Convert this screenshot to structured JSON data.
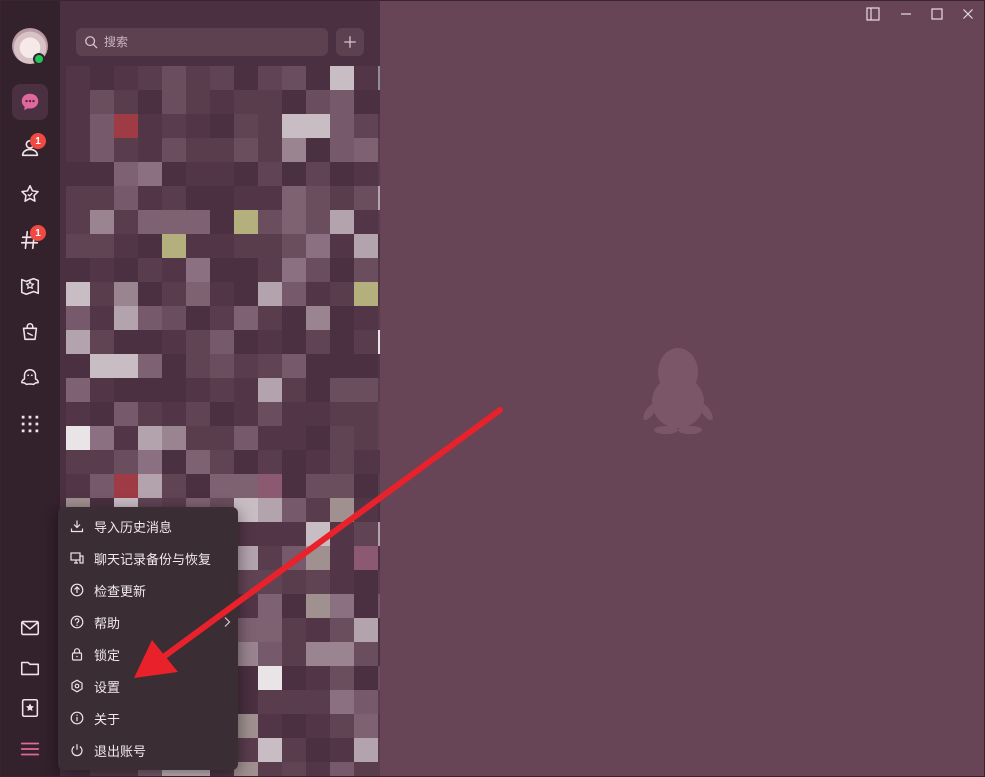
{
  "search": {
    "placeholder": "搜索"
  },
  "nav": {
    "contacts_badge": "1",
    "channels_badge": "1"
  },
  "menu": {
    "items": [
      {
        "label": "导入历史消息"
      },
      {
        "label": "聊天记录备份与恢复"
      },
      {
        "label": "检查更新"
      },
      {
        "label": "帮助"
      },
      {
        "label": "锁定"
      },
      {
        "label": "设置"
      },
      {
        "label": "关于"
      },
      {
        "label": "退出账号"
      }
    ]
  },
  "colors": {
    "accent": "#e2679c",
    "online": "#1fc65a",
    "badge": "#f04a43",
    "annotation_arrow": "#e8212b"
  }
}
